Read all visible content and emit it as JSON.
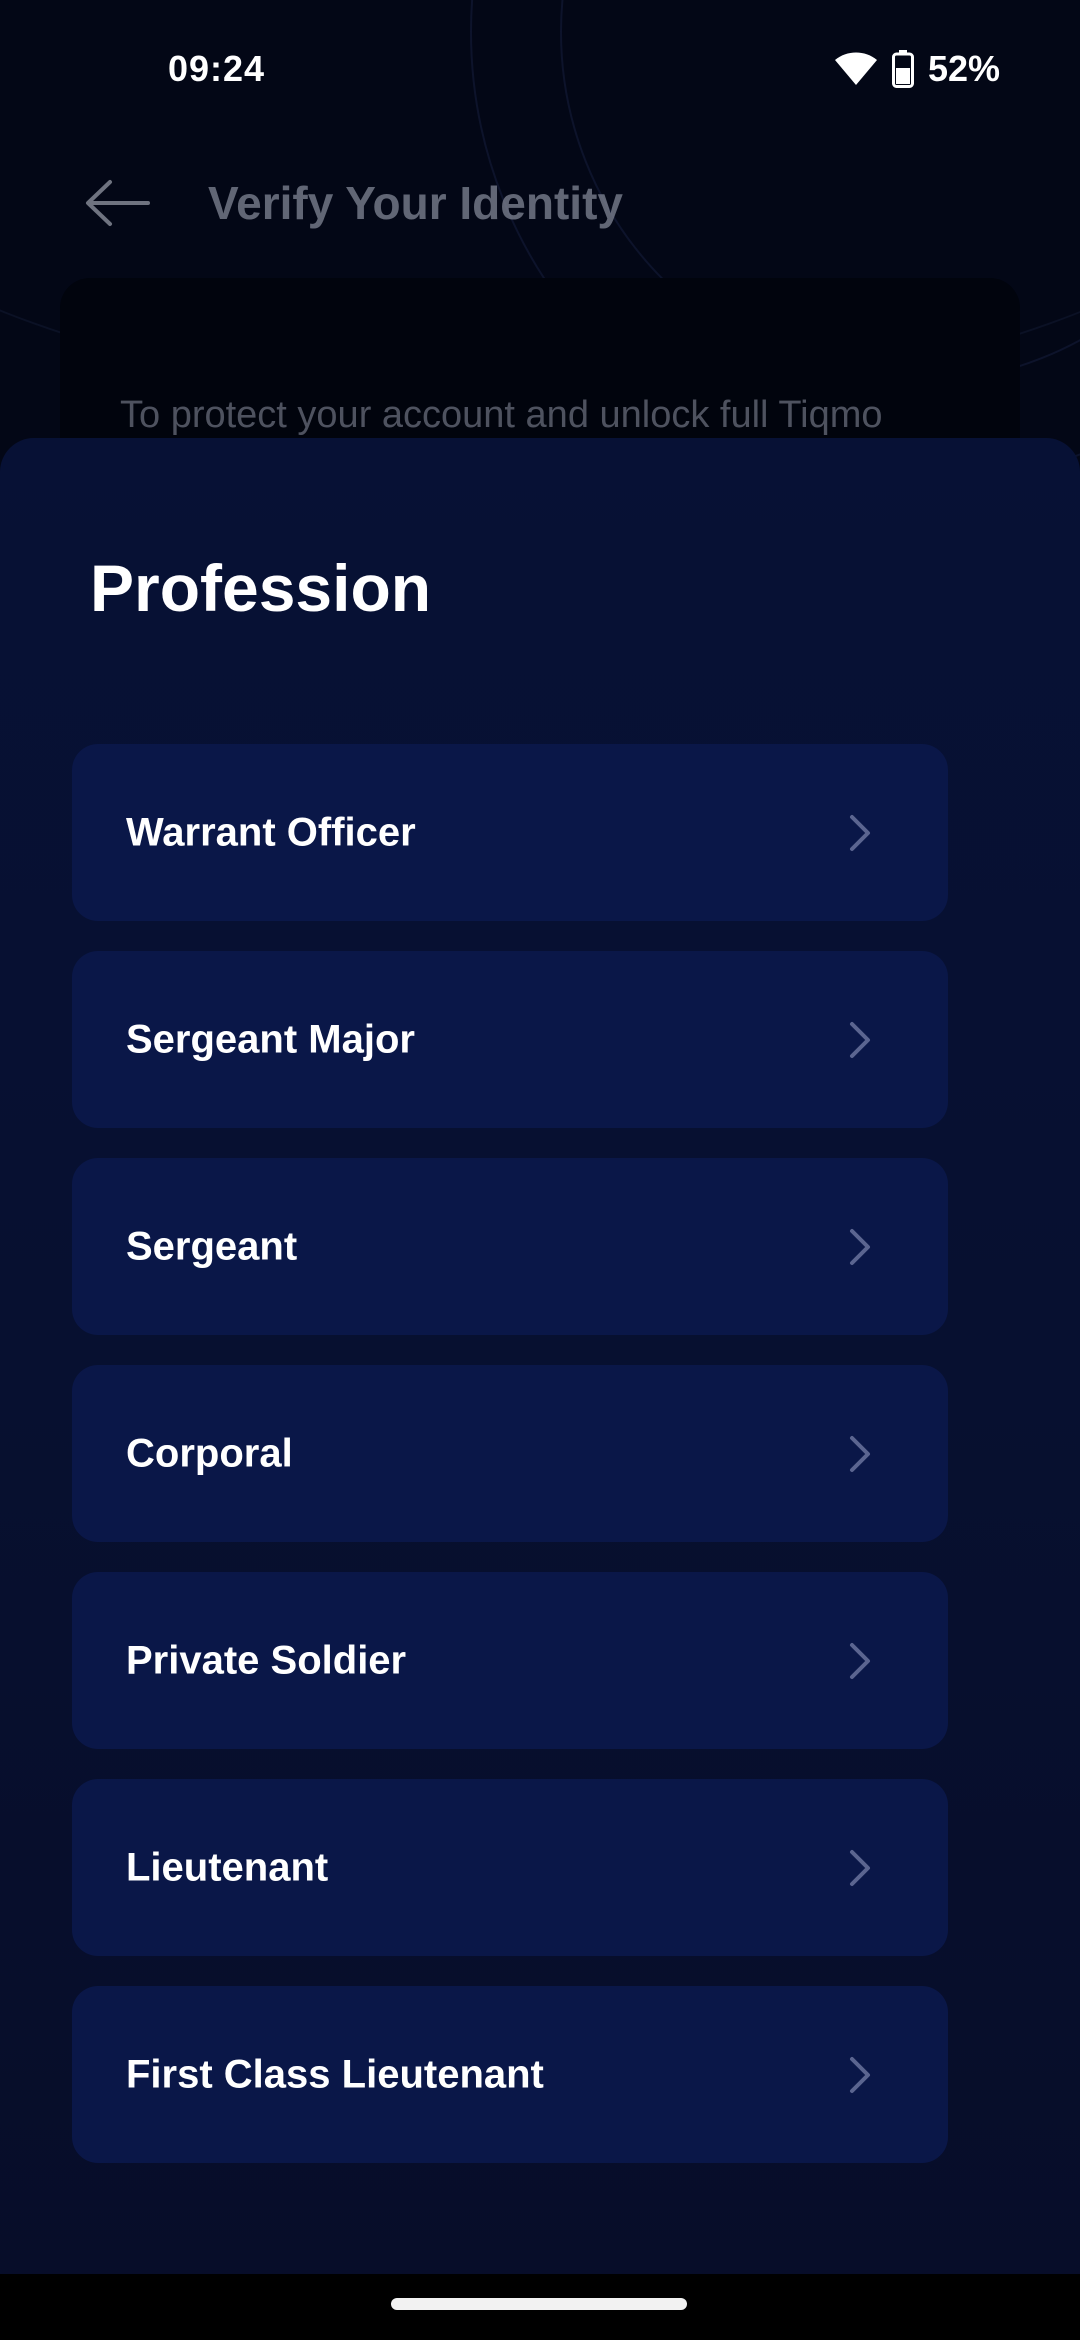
{
  "status_bar": {
    "time": "09:24",
    "battery": "52%",
    "icons": [
      "wifi-icon",
      "battery-icon"
    ]
  },
  "header": {
    "back_icon": "arrow-left-icon",
    "title": "Verify Your Identity"
  },
  "background_card": {
    "text": "To protect your account and unlock full Tiqmo"
  },
  "sheet": {
    "title": "Profession",
    "options": [
      {
        "label": "Warrant Officer",
        "icon": "chevron-right-icon"
      },
      {
        "label": "Sergeant Major",
        "icon": "chevron-right-icon"
      },
      {
        "label": "Sergeant",
        "icon": "chevron-right-icon"
      },
      {
        "label": "Corporal",
        "icon": "chevron-right-icon"
      },
      {
        "label": "Private Soldier",
        "icon": "chevron-right-icon"
      },
      {
        "label": "Lieutenant",
        "icon": "chevron-right-icon"
      },
      {
        "label": "First Class Lieutenant",
        "icon": "chevron-right-icon"
      }
    ]
  },
  "colors": {
    "sheet_background": "#071135",
    "option_background": "#0a1748",
    "text_primary": "#ffffff",
    "chevron": "#5b6590"
  }
}
